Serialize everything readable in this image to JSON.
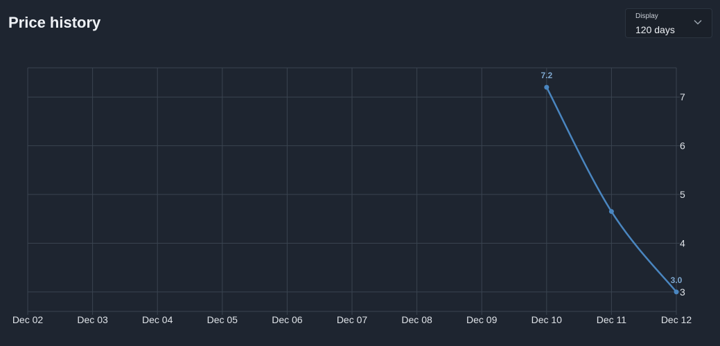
{
  "header": {
    "title": "Price history"
  },
  "display_select": {
    "label": "Display",
    "value": "120 days",
    "icon": "chevron-down-icon"
  },
  "colors": {
    "background": "#1e2530",
    "grid": "#3a4450",
    "line": "#4a86c0",
    "label": "#7fa8cf"
  },
  "chart_data": {
    "type": "line",
    "title": "Price history",
    "xlabel": "",
    "ylabel": "",
    "categories": [
      "Dec 02",
      "Dec 03",
      "Dec 04",
      "Dec 05",
      "Dec 06",
      "Dec 07",
      "Dec 08",
      "Dec 09",
      "Dec 10",
      "Dec 11",
      "Dec 12"
    ],
    "series": [
      {
        "points": [
          {
            "x": "Dec 10",
            "y": 7.2,
            "label": "7.2"
          },
          {
            "x": "Dec 11",
            "y": 4.65,
            "label": ""
          },
          {
            "x": "Dec 12",
            "y": 3.0,
            "label": "3.0"
          }
        ]
      }
    ],
    "yticks": [
      3,
      4,
      5,
      6,
      7
    ],
    "ylim": [
      2.6,
      7.6
    ],
    "grid": true,
    "y_axis_side": "right"
  }
}
